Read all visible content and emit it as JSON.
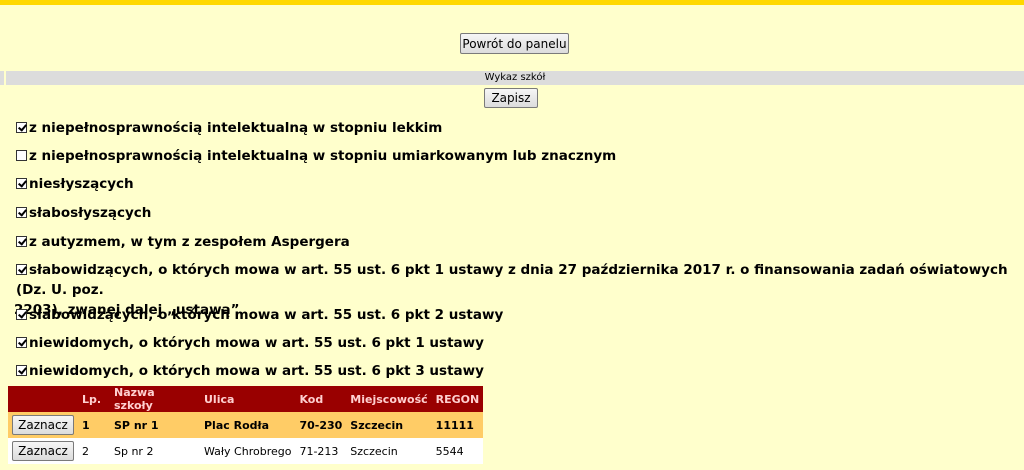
{
  "header": {
    "back_label": "Powrót do panelu"
  },
  "section": {
    "title": "Wykaz szkół",
    "save_label": "Zapisz"
  },
  "checkboxes": [
    {
      "label": "z niepełnosprawnością intelektualną w stopniu lekkim",
      "checked": true
    },
    {
      "label": "z niepełnosprawnością intelektualną w stopniu umiarkowanym lub znacznym",
      "checked": false
    },
    {
      "label": "niesłyszących",
      "checked": true
    },
    {
      "label": "słabosłyszących",
      "checked": true
    },
    {
      "label": "z autyzmem, w tym z zespołem Aspergera",
      "checked": true
    },
    {
      "label": "słabowidzących, o których mowa w art. 55 ust. 6 pkt 1 ustawy z dnia 27 października 2017 r. o finansowania zadań oświatowych (Dz. U. poz.",
      "label2": "2203), zwanej dalej „ustawą”",
      "checked": true
    },
    {
      "label": "słabowidzących, o których mowa w art. 55 ust. 6 pkt 2 ustawy",
      "checked": true
    },
    {
      "label": "niewidomych, o których mowa w art. 55 ust. 6 pkt 1 ustawy",
      "checked": true
    },
    {
      "label": "niewidomych, o których mowa w art. 55 ust. 6 pkt 3 ustawy",
      "checked": true
    }
  ],
  "table": {
    "headers": [
      "",
      "Lp.",
      "Nazwa szkoły",
      "Ulica",
      "Kod",
      "Miejscowość",
      "REGON"
    ],
    "mark_label": "Zaznacz",
    "rows": [
      {
        "lp": "1",
        "name": "SP nr 1",
        "street": "Plac Rodła",
        "code": "70-230",
        "city": "Szczecin",
        "regon": "11111"
      },
      {
        "lp": "2",
        "name": "Sp nr 2",
        "street": "Wały Chrobrego",
        "code": "71-213",
        "city": "Szczecin",
        "regon": "5544"
      }
    ]
  },
  "colors": {
    "background": "#ffffcc",
    "top_bar": "#ffd800",
    "table_header": "#990000",
    "highlight_row": "#ffcc66"
  }
}
